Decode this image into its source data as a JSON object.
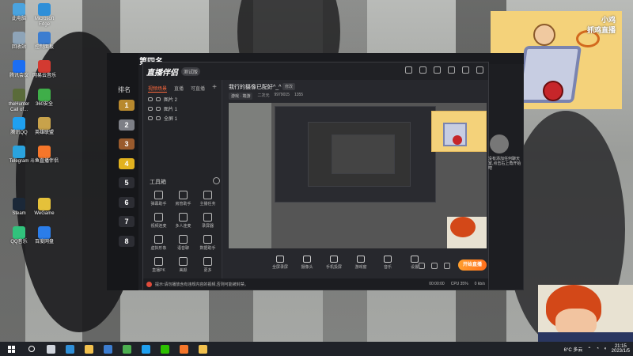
{
  "desktop": {
    "icons": [
      {
        "label": "此电脑",
        "color": "#4aa3df"
      },
      {
        "label": "Microsoft Edge",
        "color": "#2f8fd8"
      },
      {
        "label": "回收站",
        "color": "#8ea4b8"
      },
      {
        "label": "控制面板",
        "color": "#3c7dd0"
      },
      {
        "label": "腾讯会议",
        "color": "#1c6ef2"
      },
      {
        "label": "网易云音乐",
        "color": "#d33a31"
      },
      {
        "label": "theHunter Call of...",
        "color": "#5a6b3a"
      },
      {
        "label": "360安全",
        "color": "#3fae49"
      },
      {
        "label": "腾讯QQ",
        "color": "#1fa0f0"
      },
      {
        "label": "英雄联盟",
        "color": "#c8a24b"
      },
      {
        "label": "Telegram",
        "color": "#2aa3de"
      },
      {
        "label": "斗鱼直播伴侣",
        "color": "#f5762a"
      },
      {
        "label": "Steam",
        "color": "#1b2838"
      },
      {
        "label": "WeGame",
        "color": "#e5c13a"
      },
      {
        "label": "QQ音乐",
        "color": "#31c27c"
      },
      {
        "label": "百度网盘",
        "color": "#2b7de9"
      }
    ],
    "cartoon_logo": "小鸡\n抓鸡直播"
  },
  "bg_window": {
    "title": "第四名",
    "rank_title": "排名",
    "ranks": [
      {
        "n": "1",
        "color": "#b8892e"
      },
      {
        "n": "2",
        "color": "#7d7f86"
      },
      {
        "n": "3",
        "color": "#9a5b2d"
      },
      {
        "n": "4",
        "color": "#e2b21f"
      },
      {
        "n": "5",
        "color": "#2c2d33"
      },
      {
        "n": "6",
        "color": "#2c2d33"
      },
      {
        "n": "7",
        "color": "#2c2d33"
      },
      {
        "n": "8",
        "color": "#2c2d33"
      }
    ]
  },
  "live_app": {
    "logo": "直播伴侣",
    "beta": "测试版",
    "tabs": [
      "视频场景",
      "直播",
      "可直播"
    ],
    "scenes": [
      "图片 2",
      "图片 1",
      "全屏 1"
    ],
    "tools_title": "工具箱",
    "tools": [
      "弹幕助手",
      "房管助手",
      "主播任务",
      "视频连麦",
      "多人连麦",
      "录屏器",
      "虚拟形象",
      "语音聊",
      "数据助手",
      "直播PK",
      "美颜",
      "更多"
    ],
    "room_title": "我行的摄像已配好^_^",
    "room_tag": "修改",
    "meta": {
      "category": "游戏 · 端游",
      "fans": "二次元",
      "id": "9979015",
      "viewers": "1355"
    },
    "controls": [
      "全屏录屏",
      "摄像头",
      "手机投屏",
      "游戏窗",
      "音乐",
      "设置"
    ],
    "go_live": "开始直播",
    "status_text": "提示:请勿播放含有违规内容的视频,否则可能被封禁。",
    "stats": [
      "00:00:00",
      "CPU 35%",
      "0 kb/s"
    ]
  },
  "chat_side": {
    "text": "没有添加任何聊天室,点击右上角开始吧"
  },
  "taskbar": {
    "apps": [
      {
        "name": "search-icon",
        "color": "#ffffff"
      },
      {
        "name": "task-view-icon",
        "color": "#cfd4dc"
      },
      {
        "name": "edge-icon",
        "color": "#2f8fd8"
      },
      {
        "name": "file-explorer-icon",
        "color": "#f2c14e"
      },
      {
        "name": "store-icon",
        "color": "#3c7dd0"
      },
      {
        "name": "chrome-icon",
        "color": "#4caf50"
      },
      {
        "name": "qq-icon",
        "color": "#1fa0f0"
      },
      {
        "name": "wechat-icon",
        "color": "#2dc100"
      },
      {
        "name": "live-companion-icon",
        "color": "#f5762a"
      },
      {
        "name": "folder-icon",
        "color": "#f2c14e"
      }
    ],
    "weather": "6°C 多云",
    "time": "21:15",
    "date": "2023/1/5"
  }
}
